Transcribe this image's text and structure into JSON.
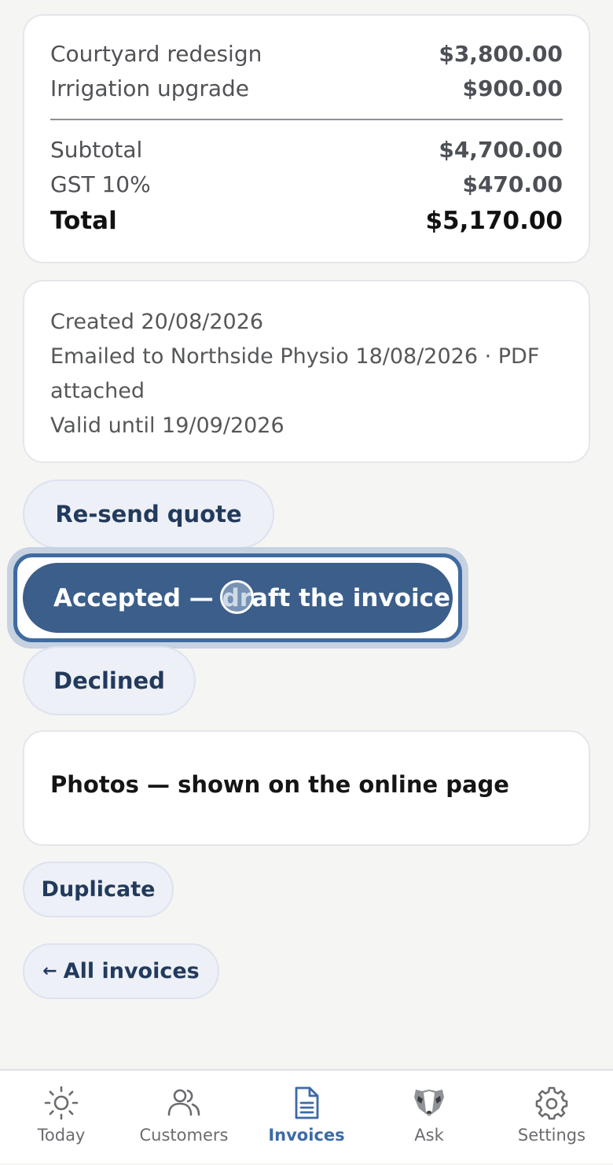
{
  "totals": {
    "items": [
      {
        "label": "Courtyard redesign",
        "amount": "$3,800.00"
      },
      {
        "label": "Irrigation upgrade",
        "amount": "$900.00"
      }
    ],
    "subtotal_label": "Subtotal",
    "subtotal": "$4,700.00",
    "gst_label": "GST 10%",
    "gst": "$470.00",
    "total_label": "Total",
    "total": "$5,170.00"
  },
  "meta": {
    "created": "Created 20/08/2026",
    "emailed": "Emailed to Northside Physio 18/08/2026 · PDF attached",
    "valid": "Valid until 19/09/2026"
  },
  "actions": {
    "resend": "Re-send quote",
    "accepted": "Accepted — draft the invoice",
    "declined": "Declined"
  },
  "photos": {
    "title": "Photos — shown on the online page"
  },
  "footer_actions": {
    "duplicate": "Duplicate",
    "all_invoices": "All invoices",
    "back_arrow": "←"
  },
  "tabs": [
    {
      "label": "Today",
      "icon": "sun-icon",
      "active": false
    },
    {
      "label": "Customers",
      "icon": "users-icon",
      "active": false
    },
    {
      "label": "Invoices",
      "icon": "document-icon",
      "active": true
    },
    {
      "label": "Ask",
      "icon": "badger-icon",
      "active": false
    },
    {
      "label": "Settings",
      "icon": "gear-icon",
      "active": false
    }
  ],
  "colors": {
    "primary": "#3b5e8b",
    "active_tab": "#3c6aa6",
    "pill_bg": "#edf0f7",
    "background": "#f5f5f3"
  }
}
